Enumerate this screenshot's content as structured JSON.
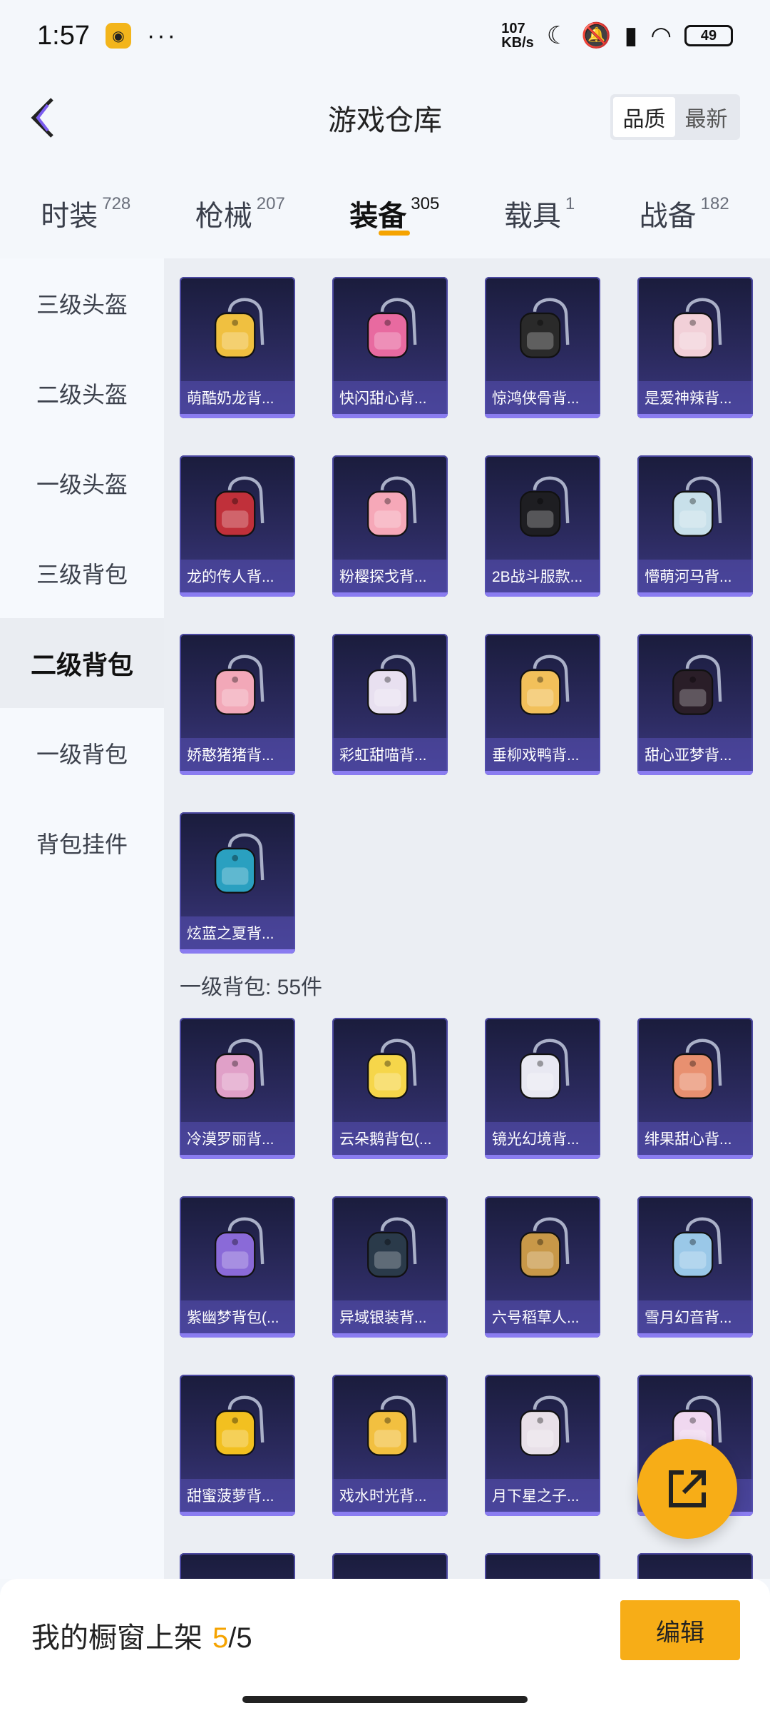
{
  "status_bar": {
    "time": "1:57",
    "speed_value": "107",
    "speed_unit": "KB/s",
    "battery": "49",
    "app_icon": "sound-app-icon",
    "more": "···"
  },
  "header": {
    "title": "游戏仓库",
    "sort_options": [
      "品质",
      "最新"
    ],
    "sort_active": "品质"
  },
  "category_tabs": [
    {
      "label": "时装",
      "count": "728"
    },
    {
      "label": "枪械",
      "count": "207"
    },
    {
      "label": "装备",
      "count": "305",
      "active": true
    },
    {
      "label": "载具",
      "count": "1"
    },
    {
      "label": "战备",
      "count": "182"
    }
  ],
  "side_nav": [
    {
      "label": "三级头盔"
    },
    {
      "label": "二级头盔"
    },
    {
      "label": "一级头盔"
    },
    {
      "label": "三级背包"
    },
    {
      "label": "二级背包",
      "active": true
    },
    {
      "label": "一级背包"
    },
    {
      "label": "背包挂件"
    }
  ],
  "section_level2": {
    "items": [
      {
        "name": "萌酷奶龙背...",
        "color": "#f0c040"
      },
      {
        "name": "快闪甜心背...",
        "color": "#e86aa0"
      },
      {
        "name": "惊鸿侠骨背...",
        "color": "#2a2a2a"
      },
      {
        "name": "是爱神辣背...",
        "color": "#f2d0d8"
      },
      {
        "name": "龙的传人背...",
        "color": "#c0303a"
      },
      {
        "name": "粉樱探戈背...",
        "color": "#f6a8b8"
      },
      {
        "name": "2B战斗服款...",
        "color": "#1e1e22"
      },
      {
        "name": "懵萌河马背...",
        "color": "#c8e0ea"
      },
      {
        "name": "娇憨猪猪背...",
        "color": "#f2a8b8"
      },
      {
        "name": "彩虹甜喵背...",
        "color": "#e8e0f0"
      },
      {
        "name": "垂柳戏鸭背...",
        "color": "#f2c05a"
      },
      {
        "name": "甜心亚梦背...",
        "color": "#2a1e28"
      },
      {
        "name": "炫蓝之夏背...",
        "color": "#2aa0c0"
      }
    ]
  },
  "section_level1": {
    "title": "一级背包: 55件",
    "items": [
      {
        "name": "冷漠罗丽背...",
        "color": "#e0a0c8"
      },
      {
        "name": "云朵鹅背包(...",
        "color": "#f6d64a"
      },
      {
        "name": "镜光幻境背...",
        "color": "#e8e8f2"
      },
      {
        "name": "绯果甜心背...",
        "color": "#e89070"
      },
      {
        "name": "紫幽梦背包(...",
        "color": "#8a6ad8"
      },
      {
        "name": "异域银装背...",
        "color": "#2a3a4a"
      },
      {
        "name": "六号稻草人...",
        "color": "#c89848"
      },
      {
        "name": "雪月幻音背...",
        "color": "#9ac8e8"
      },
      {
        "name": "甜蜜菠萝背...",
        "color": "#f2c020"
      },
      {
        "name": "戏水时光背...",
        "color": "#f2c040"
      },
      {
        "name": "月下星之子...",
        "color": "#e8e0e8"
      },
      {
        "name": "",
        "color": "#f0d8f0"
      }
    ]
  },
  "bottom_bar": {
    "showcase_label": "我的橱窗上架",
    "showcase_count": "5",
    "showcase_total": "/5",
    "edit_label": "编辑"
  },
  "icons": {
    "back": "chevron-left-icon",
    "share": "external-link-icon"
  }
}
